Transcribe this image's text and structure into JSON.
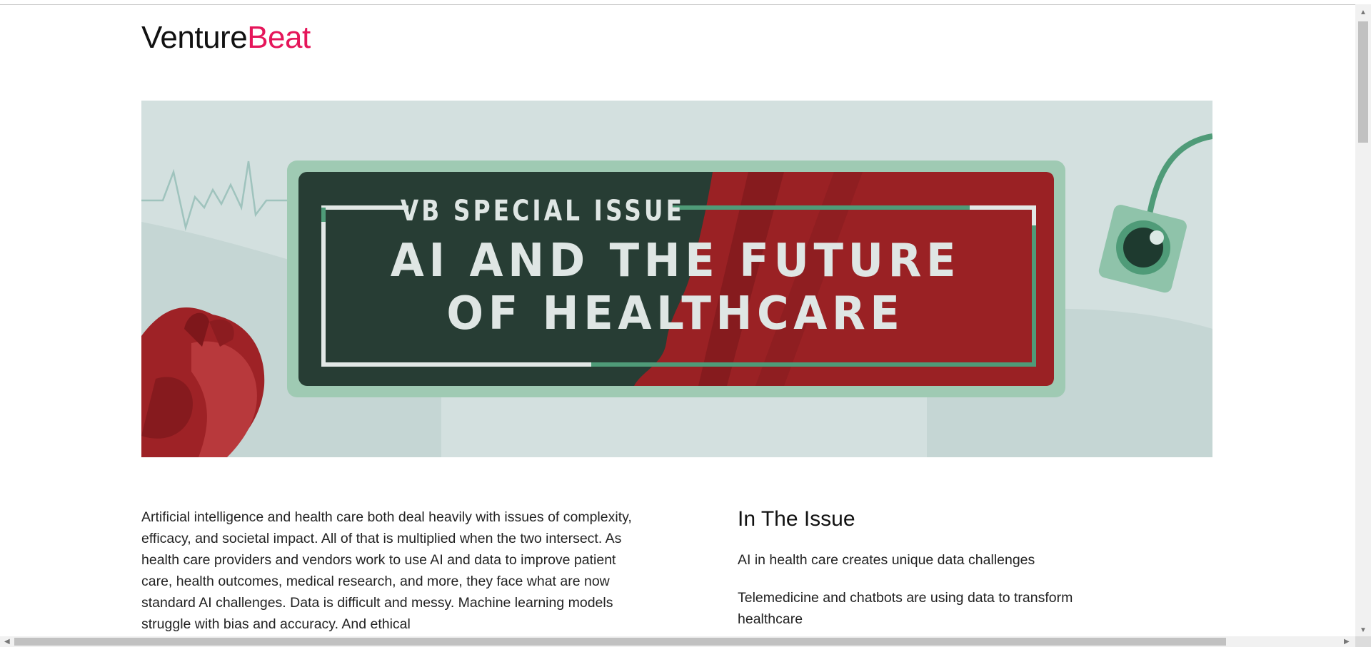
{
  "site": {
    "logo_part1": "Venture",
    "logo_part2": "Beat"
  },
  "hero": {
    "kicker": "VB SPECIAL ISSUE",
    "title_line1": "AI AND THE FUTURE",
    "title_line2": "OF HEALTHCARE"
  },
  "article": {
    "intro": "Artificial intelligence and health care both deal heavily with issues of complexity, efficacy, and societal impact. All of that is multiplied when the two intersect. As health care providers and vendors work to use AI and data to improve patient care, health outcomes, medical research, and more, they face what are now standard AI challenges. Data is difficult and messy. Machine learning models struggle with bias and accuracy. And ethical"
  },
  "sidebar": {
    "heading": "In The Issue",
    "links": [
      "AI in health care creates unique data challenges",
      "Telemedicine and chatbots are using data to transform healthcare"
    ]
  },
  "colors": {
    "brand_pink": "#e5165a",
    "banner_green": "#273d34",
    "banner_red": "#9a2124",
    "accent_green": "#4f9b78"
  }
}
